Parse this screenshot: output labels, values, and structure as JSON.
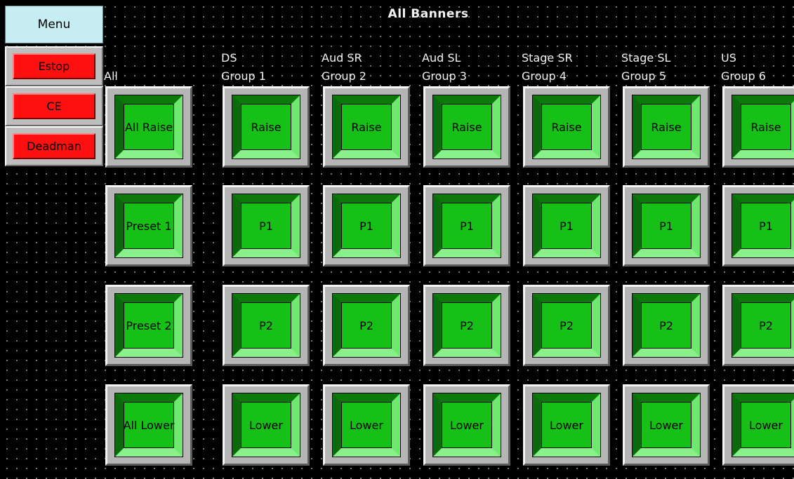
{
  "title": "All Banners",
  "sidebar": {
    "menu_label": "Menu",
    "estop_label": "Estop",
    "ce_label": "CE",
    "deadman_label": "Deadman"
  },
  "columns": [
    {
      "line1": "",
      "line2": "All",
      "raise": "All Raise",
      "p1": "Preset 1",
      "p2": "Preset 2",
      "lower": "All Lower"
    },
    {
      "line1": "DS",
      "line2": "Group 1",
      "raise": "Raise",
      "p1": "P1",
      "p2": "P2",
      "lower": "Lower"
    },
    {
      "line1": "Aud SR",
      "line2": "Group 2",
      "raise": "Raise",
      "p1": "P1",
      "p2": "P2",
      "lower": "Lower"
    },
    {
      "line1": "Aud SL",
      "line2": "Group 3",
      "raise": "Raise",
      "p1": "P1",
      "p2": "P2",
      "lower": "Lower"
    },
    {
      "line1": "Stage SR",
      "line2": "Group 4",
      "raise": "Raise",
      "p1": "P1",
      "p2": "P2",
      "lower": "Lower"
    },
    {
      "line1": "Stage SL",
      "line2": "Group 5",
      "raise": "Raise",
      "p1": "P1",
      "p2": "P2",
      "lower": "Lower"
    },
    {
      "line1": "US",
      "line2": "Group 6",
      "raise": "Raise",
      "p1": "P1",
      "p2": "P2",
      "lower": "Lower"
    }
  ],
  "colors": {
    "background": "#000000",
    "menu": "#c6eef2",
    "safety": "#ff1010",
    "button_face": "#18b818"
  }
}
